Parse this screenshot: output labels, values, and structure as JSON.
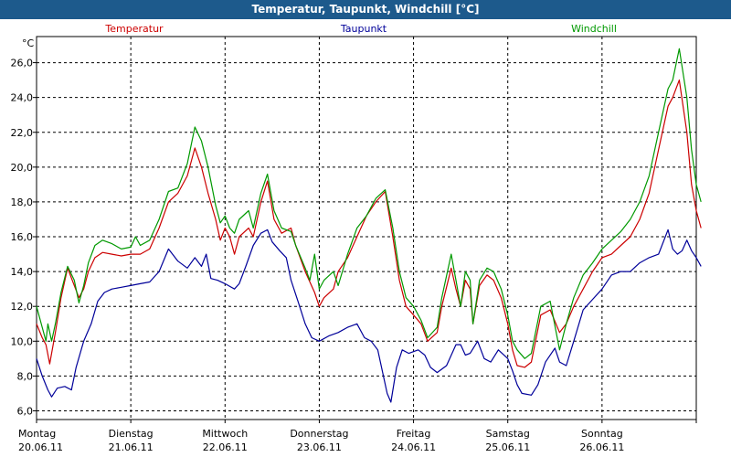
{
  "window": {
    "title": "Temperatur, Taupunkt, Windchill [°C]"
  },
  "chart_data": {
    "type": "line",
    "title": "Temperatur, Taupunkt, Windchill [°C]",
    "ylabel": "°C",
    "xlabel": "",
    "ylim": [
      5.5,
      27.5
    ],
    "xlim": [
      0,
      7
    ],
    "y_ticks": [
      6.0,
      8.0,
      10.0,
      12.0,
      14.0,
      16.0,
      18.0,
      20.0,
      22.0,
      24.0,
      26.0
    ],
    "y_tick_labels": [
      "6,0",
      "8,0",
      "10,0",
      "12,0",
      "14,0",
      "16,0",
      "18,0",
      "20,0",
      "22,0",
      "24,0",
      "26,0"
    ],
    "x_tick_labels": [
      {
        "day": "Montag",
        "date": "20.06.11"
      },
      {
        "day": "Dienstag",
        "date": "21.06.11"
      },
      {
        "day": "Mittwoch",
        "date": "22.06.11"
      },
      {
        "day": "Donnerstag",
        "date": "23.06.11"
      },
      {
        "day": "Freitag",
        "date": "24.06.11"
      },
      {
        "day": "Samstag",
        "date": "25.06.11"
      },
      {
        "day": "Sonntag",
        "date": "26.06.11"
      }
    ],
    "grid": true,
    "legend_placement": "top",
    "colors": {
      "Temperatur": "#cc0000",
      "Taupunkt": "#000099",
      "Windchill": "#009900"
    },
    "series": [
      {
        "name": "Temperatur",
        "points": [
          [
            0.0,
            11.0
          ],
          [
            0.06,
            10.2
          ],
          [
            0.1,
            9.8
          ],
          [
            0.14,
            8.7
          ],
          [
            0.2,
            10.5
          ],
          [
            0.26,
            12.5
          ],
          [
            0.33,
            14.2
          ],
          [
            0.4,
            13.2
          ],
          [
            0.45,
            12.5
          ],
          [
            0.5,
            13.0
          ],
          [
            0.55,
            14.0
          ],
          [
            0.62,
            14.8
          ],
          [
            0.7,
            15.1
          ],
          [
            0.8,
            15.0
          ],
          [
            0.9,
            14.9
          ],
          [
            1.0,
            15.0
          ],
          [
            1.1,
            15.0
          ],
          [
            1.2,
            15.3
          ],
          [
            1.3,
            16.5
          ],
          [
            1.4,
            18.0
          ],
          [
            1.5,
            18.5
          ],
          [
            1.6,
            19.5
          ],
          [
            1.68,
            21.1
          ],
          [
            1.75,
            20.0
          ],
          [
            1.82,
            18.5
          ],
          [
            1.9,
            17.0
          ],
          [
            1.95,
            15.8
          ],
          [
            2.0,
            16.5
          ],
          [
            2.05,
            16.0
          ],
          [
            2.1,
            15.0
          ],
          [
            2.15,
            16.0
          ],
          [
            2.25,
            16.5
          ],
          [
            2.3,
            16.0
          ],
          [
            2.38,
            18.0
          ],
          [
            2.45,
            19.2
          ],
          [
            2.52,
            17.0
          ],
          [
            2.6,
            16.2
          ],
          [
            2.7,
            16.5
          ],
          [
            2.75,
            15.5
          ],
          [
            2.85,
            14.0
          ],
          [
            2.95,
            12.8
          ],
          [
            3.0,
            12.0
          ],
          [
            3.05,
            12.5
          ],
          [
            3.15,
            13.0
          ],
          [
            3.2,
            14.0
          ],
          [
            3.3,
            14.8
          ],
          [
            3.4,
            16.0
          ],
          [
            3.5,
            17.2
          ],
          [
            3.6,
            18.0
          ],
          [
            3.7,
            18.6
          ],
          [
            3.78,
            16.0
          ],
          [
            3.85,
            13.5
          ],
          [
            3.92,
            12.0
          ],
          [
            4.0,
            11.5
          ],
          [
            4.08,
            11.0
          ],
          [
            4.15,
            10.0
          ],
          [
            4.25,
            10.5
          ],
          [
            4.3,
            12.0
          ],
          [
            4.4,
            14.2
          ],
          [
            4.45,
            13.0
          ],
          [
            4.5,
            12.0
          ],
          [
            4.55,
            13.5
          ],
          [
            4.6,
            13.0
          ],
          [
            4.63,
            11.0
          ],
          [
            4.7,
            13.2
          ],
          [
            4.78,
            13.8
          ],
          [
            4.85,
            13.5
          ],
          [
            4.93,
            12.5
          ],
          [
            5.0,
            11.0
          ],
          [
            5.05,
            9.5
          ],
          [
            5.1,
            8.6
          ],
          [
            5.18,
            8.5
          ],
          [
            5.25,
            8.8
          ],
          [
            5.35,
            11.5
          ],
          [
            5.45,
            11.8
          ],
          [
            5.55,
            10.5
          ],
          [
            5.62,
            11.0
          ],
          [
            5.7,
            12.0
          ],
          [
            5.8,
            13.0
          ],
          [
            5.9,
            14.0
          ],
          [
            6.0,
            14.8
          ],
          [
            6.1,
            15.0
          ],
          [
            6.2,
            15.5
          ],
          [
            6.3,
            16.0
          ],
          [
            6.4,
            17.0
          ],
          [
            6.5,
            18.5
          ],
          [
            6.6,
            21.0
          ],
          [
            6.7,
            23.5
          ],
          [
            6.75,
            24.0
          ],
          [
            6.82,
            25.0
          ],
          [
            6.9,
            22.0
          ],
          [
            6.95,
            19.0
          ],
          [
            7.0,
            17.5
          ],
          [
            7.05,
            16.5
          ]
        ]
      },
      {
        "name": "Taupunkt",
        "points": [
          [
            0.0,
            9.0
          ],
          [
            0.06,
            8.0
          ],
          [
            0.12,
            7.2
          ],
          [
            0.16,
            6.8
          ],
          [
            0.22,
            7.3
          ],
          [
            0.3,
            7.4
          ],
          [
            0.37,
            7.2
          ],
          [
            0.42,
            8.5
          ],
          [
            0.5,
            10.0
          ],
          [
            0.58,
            11.0
          ],
          [
            0.65,
            12.3
          ],
          [
            0.72,
            12.8
          ],
          [
            0.8,
            13.0
          ],
          [
            0.9,
            13.1
          ],
          [
            1.0,
            13.2
          ],
          [
            1.1,
            13.3
          ],
          [
            1.2,
            13.4
          ],
          [
            1.3,
            14.0
          ],
          [
            1.4,
            15.3
          ],
          [
            1.5,
            14.6
          ],
          [
            1.6,
            14.2
          ],
          [
            1.68,
            14.8
          ],
          [
            1.75,
            14.3
          ],
          [
            1.8,
            15.0
          ],
          [
            1.85,
            13.6
          ],
          [
            1.92,
            13.5
          ],
          [
            2.0,
            13.3
          ],
          [
            2.1,
            13.0
          ],
          [
            2.15,
            13.3
          ],
          [
            2.22,
            14.3
          ],
          [
            2.3,
            15.5
          ],
          [
            2.38,
            16.2
          ],
          [
            2.45,
            16.4
          ],
          [
            2.5,
            15.7
          ],
          [
            2.58,
            15.2
          ],
          [
            2.65,
            14.8
          ],
          [
            2.7,
            13.5
          ],
          [
            2.78,
            12.2
          ],
          [
            2.85,
            11.0
          ],
          [
            2.92,
            10.2
          ],
          [
            3.0,
            10.0
          ],
          [
            3.1,
            10.3
          ],
          [
            3.2,
            10.5
          ],
          [
            3.3,
            10.8
          ],
          [
            3.4,
            11.0
          ],
          [
            3.48,
            10.2
          ],
          [
            3.55,
            10.0
          ],
          [
            3.62,
            9.5
          ],
          [
            3.68,
            8.0
          ],
          [
            3.72,
            7.0
          ],
          [
            3.76,
            6.5
          ],
          [
            3.82,
            8.5
          ],
          [
            3.88,
            9.5
          ],
          [
            3.95,
            9.3
          ],
          [
            4.05,
            9.5
          ],
          [
            4.12,
            9.2
          ],
          [
            4.18,
            8.5
          ],
          [
            4.25,
            8.2
          ],
          [
            4.35,
            8.6
          ],
          [
            4.45,
            9.8
          ],
          [
            4.5,
            9.8
          ],
          [
            4.55,
            9.2
          ],
          [
            4.6,
            9.3
          ],
          [
            4.68,
            10.0
          ],
          [
            4.75,
            9.0
          ],
          [
            4.82,
            8.8
          ],
          [
            4.9,
            9.5
          ],
          [
            5.0,
            9.0
          ],
          [
            5.05,
            8.3
          ],
          [
            5.1,
            7.5
          ],
          [
            5.15,
            7.0
          ],
          [
            5.25,
            6.9
          ],
          [
            5.32,
            7.5
          ],
          [
            5.4,
            8.8
          ],
          [
            5.5,
            9.6
          ],
          [
            5.55,
            8.8
          ],
          [
            5.62,
            8.6
          ],
          [
            5.7,
            10.0
          ],
          [
            5.8,
            11.8
          ],
          [
            5.9,
            12.4
          ],
          [
            6.0,
            13.0
          ],
          [
            6.1,
            13.8
          ],
          [
            6.2,
            14.0
          ],
          [
            6.3,
            14.0
          ],
          [
            6.4,
            14.5
          ],
          [
            6.5,
            14.8
          ],
          [
            6.6,
            15.0
          ],
          [
            6.7,
            16.4
          ],
          [
            6.75,
            15.3
          ],
          [
            6.8,
            15.0
          ],
          [
            6.85,
            15.2
          ],
          [
            6.9,
            15.8
          ],
          [
            6.95,
            15.2
          ],
          [
            7.0,
            14.8
          ],
          [
            7.05,
            14.3
          ]
        ]
      },
      {
        "name": "Windchill",
        "points": [
          [
            0.0,
            12.0
          ],
          [
            0.06,
            10.8
          ],
          [
            0.1,
            10.0
          ],
          [
            0.12,
            11.0
          ],
          [
            0.16,
            10.0
          ],
          [
            0.2,
            11.0
          ],
          [
            0.26,
            12.8
          ],
          [
            0.33,
            14.3
          ],
          [
            0.4,
            13.5
          ],
          [
            0.45,
            12.2
          ],
          [
            0.5,
            13.2
          ],
          [
            0.55,
            14.5
          ],
          [
            0.62,
            15.5
          ],
          [
            0.7,
            15.8
          ],
          [
            0.8,
            15.6
          ],
          [
            0.9,
            15.3
          ],
          [
            1.0,
            15.4
          ],
          [
            1.05,
            16.0
          ],
          [
            1.1,
            15.5
          ],
          [
            1.2,
            15.8
          ],
          [
            1.3,
            17.0
          ],
          [
            1.4,
            18.6
          ],
          [
            1.5,
            18.8
          ],
          [
            1.6,
            20.2
          ],
          [
            1.68,
            22.3
          ],
          [
            1.75,
            21.5
          ],
          [
            1.82,
            20.0
          ],
          [
            1.9,
            17.8
          ],
          [
            1.95,
            16.8
          ],
          [
            2.0,
            17.2
          ],
          [
            2.05,
            16.5
          ],
          [
            2.1,
            16.2
          ],
          [
            2.15,
            17.0
          ],
          [
            2.25,
            17.5
          ],
          [
            2.3,
            16.5
          ],
          [
            2.38,
            18.5
          ],
          [
            2.45,
            19.6
          ],
          [
            2.52,
            17.5
          ],
          [
            2.6,
            16.5
          ],
          [
            2.7,
            16.3
          ],
          [
            2.75,
            15.5
          ],
          [
            2.85,
            14.2
          ],
          [
            2.9,
            13.5
          ],
          [
            2.95,
            15.0
          ],
          [
            3.0,
            13.0
          ],
          [
            3.05,
            13.5
          ],
          [
            3.15,
            14.0
          ],
          [
            3.2,
            13.2
          ],
          [
            3.3,
            15.0
          ],
          [
            3.4,
            16.5
          ],
          [
            3.5,
            17.2
          ],
          [
            3.6,
            18.2
          ],
          [
            3.7,
            18.7
          ],
          [
            3.78,
            16.5
          ],
          [
            3.85,
            14.0
          ],
          [
            3.92,
            12.5
          ],
          [
            4.0,
            12.0
          ],
          [
            4.08,
            11.2
          ],
          [
            4.15,
            10.2
          ],
          [
            4.25,
            10.8
          ],
          [
            4.3,
            12.5
          ],
          [
            4.4,
            15.0
          ],
          [
            4.45,
            13.5
          ],
          [
            4.5,
            12.0
          ],
          [
            4.55,
            14.0
          ],
          [
            4.6,
            13.5
          ],
          [
            4.63,
            11.0
          ],
          [
            4.7,
            13.5
          ],
          [
            4.78,
            14.2
          ],
          [
            4.85,
            14.0
          ],
          [
            4.93,
            13.0
          ],
          [
            5.0,
            11.5
          ],
          [
            5.05,
            10.0
          ],
          [
            5.1,
            9.5
          ],
          [
            5.18,
            9.0
          ],
          [
            5.25,
            9.3
          ],
          [
            5.35,
            12.0
          ],
          [
            5.45,
            12.3
          ],
          [
            5.55,
            9.5
          ],
          [
            5.62,
            11.0
          ],
          [
            5.7,
            12.5
          ],
          [
            5.8,
            13.8
          ],
          [
            5.9,
            14.5
          ],
          [
            6.0,
            15.3
          ],
          [
            6.1,
            15.8
          ],
          [
            6.2,
            16.3
          ],
          [
            6.3,
            17.0
          ],
          [
            6.4,
            18.0
          ],
          [
            6.5,
            19.5
          ],
          [
            6.6,
            22.0
          ],
          [
            6.7,
            24.5
          ],
          [
            6.75,
            25.0
          ],
          [
            6.82,
            26.8
          ],
          [
            6.9,
            24.0
          ],
          [
            6.95,
            21.0
          ],
          [
            7.0,
            19.0
          ],
          [
            7.05,
            18.0
          ]
        ]
      }
    ]
  }
}
